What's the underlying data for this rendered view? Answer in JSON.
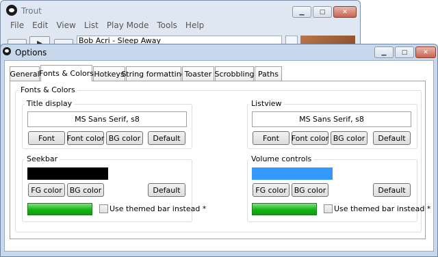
{
  "main_window": {
    "title": "Trout",
    "menu": [
      "File",
      "Edit",
      "View",
      "List",
      "Play Mode",
      "Tools",
      "Help"
    ],
    "now_playing": "Bob Acri - Sleep Away"
  },
  "options_window": {
    "title": "Options",
    "tabs": [
      "General",
      "Fonts & Colors",
      "Hotkeys",
      "String formatting",
      "Toaster",
      "Scrobbling",
      "Paths"
    ],
    "active_tab": "Fonts & Colors",
    "page_title": "Fonts & Colors",
    "title_display": {
      "label": "Title display",
      "preview": "MS Sans Serif, s8",
      "buttons": [
        "Font",
        "Font color",
        "BG color",
        "Default"
      ]
    },
    "listview": {
      "label": "Listview",
      "preview": "MS Sans Serif, s8",
      "buttons": [
        "Font",
        "Font color",
        "BG color",
        "Default"
      ]
    },
    "seekbar": {
      "label": "Seekbar",
      "color": "#000000",
      "buttons": [
        "FG color",
        "BG color",
        "Default"
      ],
      "themed_label": "Use themed bar instead *",
      "themed_checked": false
    },
    "volume_controls": {
      "label": "Volume controls",
      "color": "#3399ff",
      "buttons": [
        "FG color",
        "BG color",
        "Default"
      ],
      "themed_label": "Use themed bar instead *",
      "themed_checked": false
    }
  },
  "colors": {
    "themed_bar_green": "#15b515",
    "frame_blue": "#c7d8ec"
  }
}
